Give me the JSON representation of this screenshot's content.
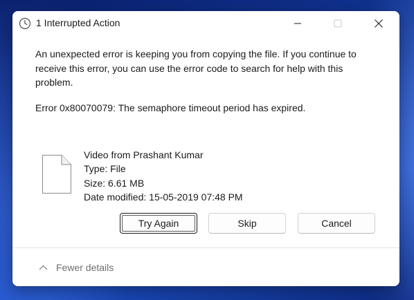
{
  "window": {
    "title": "1 Interrupted Action",
    "title_icon": "clock-icon",
    "controls": {
      "minimize_icon": "minimize-icon",
      "maximize_icon": "maximize-icon",
      "close_icon": "close-icon"
    }
  },
  "message": {
    "text": "An unexpected error is keeping you from copying the file. If you continue to receive this error, you can use the error code to search for help with this problem.",
    "error": "Error 0x80070079: The semaphore timeout period has expired."
  },
  "file": {
    "icon": "file-icon",
    "name": "Video from Prashant Kumar",
    "type": "Type: File",
    "size": "Size: 6.61 MB",
    "date_modified": "Date modified: 15-05-2019 07:48 PM"
  },
  "buttons": {
    "try_again": "Try Again",
    "skip": "Skip",
    "cancel": "Cancel"
  },
  "footer": {
    "details_label": "Fewer details",
    "details_icon": "chevron-up-icon"
  },
  "colors": {
    "desktop_bg": "#1c4fc4",
    "dialog_bg": "#ffffff",
    "text": "#1a1a1a",
    "muted_text": "#6e6e6e"
  }
}
